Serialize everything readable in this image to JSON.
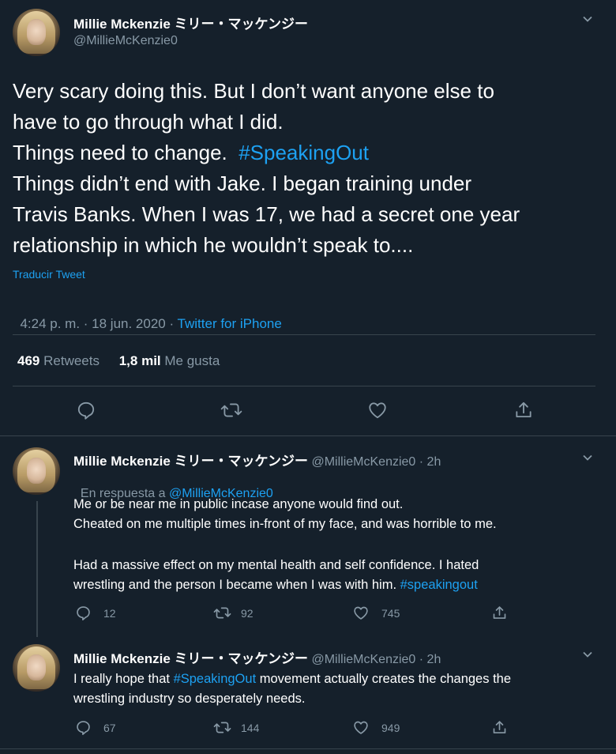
{
  "main_tweet": {
    "author_name": "Millie Mckenzie ミリー・マッケンジー",
    "handle": "@MillieMcKenzie0",
    "text_lines": [
      "Very scary doing this. But I don’t want anyone else to",
      "have to go through what I did.",
      "Things need to change.  ",
      "Things didn’t end with Jake. I began training under",
      "Travis Banks. When I was 17, we had a secret one year",
      "relationship in which he wouldn’t speak to...."
    ],
    "hashtag": "#SpeakingOut",
    "translate": "Traducir Tweet",
    "timestamp": "4:24 p. m. · 18 jun. 2020 · ",
    "source": "Twitter for iPhone",
    "retweets_count": "469",
    "retweets_label": "Retweets",
    "likes_count": "1,8 mil",
    "likes_label": "Me gusta"
  },
  "replies": [
    {
      "author_name": "Millie Mckenzie ミリー・マッケンジー",
      "meta": "@MillieMcKenzie0 · 2h",
      "reply_prefix": "En respuesta a ",
      "reply_to": "@MillieMcKenzie0",
      "lines": [
        "Me or be near me in public incase anyone would find out.",
        "Cheated on me multiple times in-front of my face, and was horrible to me.",
        "",
        "Had a massive effect on my mental health and self confidence. I hated",
        "wrestling and the person I became when I was with him. "
      ],
      "hashtag": "#speakingout",
      "reply_count": "12",
      "retweet_count": "92",
      "like_count": "745"
    },
    {
      "author_name": "Millie Mckenzie ミリー・マッケンジー",
      "meta": "@MillieMcKenzie0 · 2h",
      "line1_prefix": "I really hope that ",
      "hashtag": "#SpeakingOut",
      "line1_suffix": " movement actually creates the changes the",
      "line2": "wrestling industry so desperately needs.",
      "reply_count": "67",
      "retweet_count": "144",
      "like_count": "949"
    }
  ],
  "colors": {
    "background": "#15202b",
    "accent": "#1da1f2",
    "muted": "#8899a6",
    "divider": "#38444d"
  },
  "icons": [
    "avatar",
    "chevron-down-icon",
    "reply-icon",
    "retweet-icon",
    "like-icon",
    "share-icon"
  ]
}
